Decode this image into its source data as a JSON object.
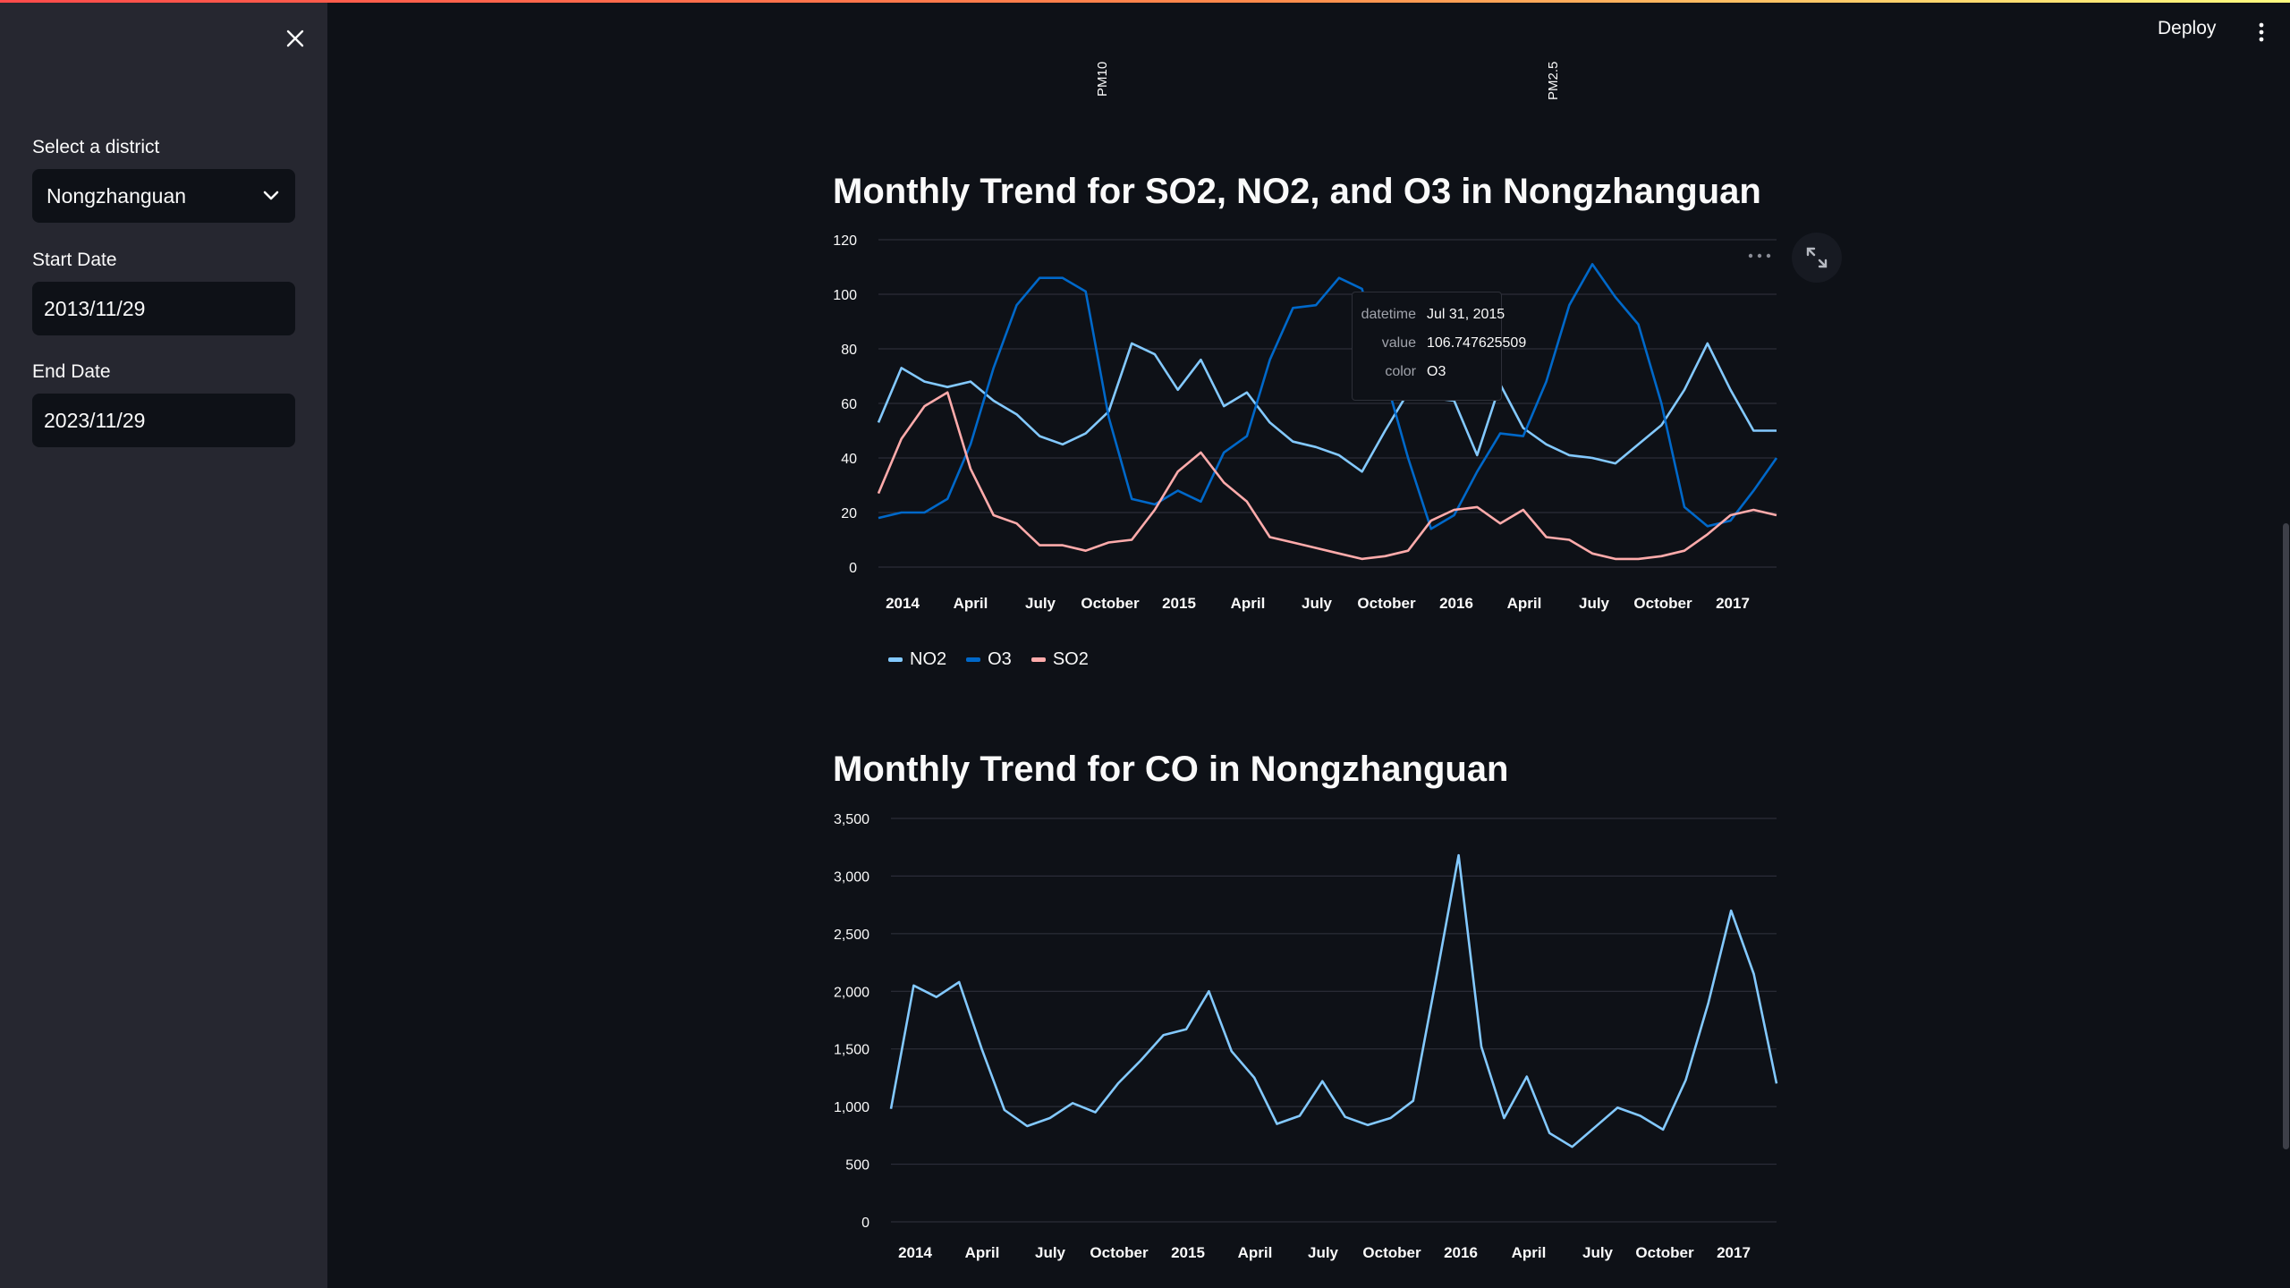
{
  "window": {
    "deploy_label": "Deploy"
  },
  "sidebar": {
    "district_label": "Select a district",
    "district_value": "Nongzhanguan",
    "start_label": "Start Date",
    "start_value": "2013/11/29",
    "end_label": "End Date",
    "end_value": "2023/11/29"
  },
  "above_fold_labels": [
    "PM10",
    "PM2.5"
  ],
  "colors": {
    "background": "#0e1117",
    "sidebar": "#262730",
    "NO2": "#83c9ff",
    "O3": "#0068c9",
    "SO2": "#ffabab",
    "CO": "#83c9ff"
  },
  "icons": [
    "close-icon",
    "chevron-down-icon",
    "more-vert-icon",
    "more-horiz-icon",
    "fullscreen-icon"
  ],
  "chart1_title": "Monthly Trend for SO2, NO2, and O3 in Nongzhanguan",
  "chart2_title": "Monthly Trend for CO in Nongzhanguan",
  "tooltip": {
    "rows": [
      {
        "key": "datetime",
        "value": "Jul 31, 2015"
      },
      {
        "key": "value",
        "value": "106.747625509"
      },
      {
        "key": "color",
        "value": "O3"
      }
    ]
  },
  "chart_data": [
    {
      "type": "line",
      "title": "Monthly Trend for SO2, NO2, and O3 in Nongzhanguan",
      "x_ticks": [
        "2014",
        "April",
        "July",
        "October",
        "2015",
        "April",
        "July",
        "October",
        "2016",
        "April",
        "July",
        "October",
        "2017"
      ],
      "y_ticks": [
        "0",
        "20",
        "40",
        "60",
        "80",
        "100",
        "120"
      ],
      "ylim": [
        0,
        120
      ],
      "legend": [
        "NO2",
        "O3",
        "SO2"
      ],
      "legend_position": "bottom-left",
      "grid": true,
      "x_months": [
        "2013-11",
        "2013-12",
        "2014-01",
        "2014-02",
        "2014-03",
        "2014-04",
        "2014-05",
        "2014-06",
        "2014-07",
        "2014-08",
        "2014-09",
        "2014-10",
        "2014-11",
        "2014-12",
        "2015-01",
        "2015-02",
        "2015-03",
        "2015-04",
        "2015-05",
        "2015-06",
        "2015-07",
        "2015-08",
        "2015-09",
        "2015-10",
        "2015-11",
        "2015-12",
        "2016-01",
        "2016-02",
        "2016-03",
        "2016-04",
        "2016-05",
        "2016-06",
        "2016-07",
        "2016-08",
        "2016-09",
        "2016-10",
        "2016-11",
        "2016-12",
        "2017-01",
        "2017-02"
      ],
      "series": [
        {
          "name": "NO2",
          "values": [
            53,
            73,
            68,
            66,
            68,
            61,
            56,
            48,
            45,
            49,
            57,
            82,
            78,
            65,
            76,
            59,
            64,
            53,
            46,
            44,
            41,
            35,
            50,
            64,
            62,
            61,
            41,
            67,
            51,
            45,
            41,
            40,
            38,
            45,
            52,
            65,
            82,
            65,
            50,
            50
          ]
        },
        {
          "name": "O3",
          "values": [
            18,
            20,
            20,
            25,
            45,
            73,
            96,
            106,
            106,
            101,
            55,
            25,
            23,
            28,
            24,
            42,
            48,
            76,
            95,
            96,
            106,
            102,
            70,
            40,
            14,
            19,
            35,
            49,
            48,
            68,
            96,
            111,
            99,
            89,
            60,
            22,
            15,
            17,
            28,
            40
          ]
        },
        {
          "name": "SO2",
          "values": [
            27,
            47,
            59,
            64,
            36,
            19,
            16,
            8,
            8,
            6,
            9,
            10,
            21,
            35,
            42,
            31,
            24,
            11,
            9,
            7,
            5,
            3,
            4,
            6,
            17,
            21,
            22,
            16,
            21,
            11,
            10,
            5,
            3,
            3,
            4,
            6,
            12,
            19,
            21,
            19
          ]
        }
      ]
    },
    {
      "type": "line",
      "title": "Monthly Trend for CO in Nongzhanguan",
      "x_ticks": [
        "2014",
        "April",
        "July",
        "October",
        "2015",
        "April",
        "July",
        "October",
        "2016",
        "April",
        "July",
        "October",
        "2017"
      ],
      "y_ticks": [
        "0",
        "500",
        "1,000",
        "1,500",
        "2,000",
        "2,500",
        "3,000",
        "3,500"
      ],
      "ylim": [
        0,
        3500
      ],
      "grid": true,
      "x_months": [
        "2013-11",
        "2013-12",
        "2014-01",
        "2014-02",
        "2014-03",
        "2014-04",
        "2014-05",
        "2014-06",
        "2014-07",
        "2014-08",
        "2014-09",
        "2014-10",
        "2014-11",
        "2014-12",
        "2015-01",
        "2015-02",
        "2015-03",
        "2015-04",
        "2015-05",
        "2015-06",
        "2015-07",
        "2015-08",
        "2015-09",
        "2015-10",
        "2015-11",
        "2015-12",
        "2016-01",
        "2016-02",
        "2016-03",
        "2016-04",
        "2016-05",
        "2016-06",
        "2016-07",
        "2016-08",
        "2016-09",
        "2016-10",
        "2016-11",
        "2016-12",
        "2017-01",
        "2017-02"
      ],
      "series": [
        {
          "name": "CO",
          "values": [
            980,
            2050,
            1950,
            2080,
            1500,
            970,
            830,
            900,
            1030,
            950,
            1200,
            1400,
            1620,
            1670,
            2000,
            1480,
            1250,
            850,
            920,
            1220,
            910,
            840,
            900,
            1050,
            2100,
            3180,
            1520,
            900,
            1260,
            770,
            650,
            820,
            990,
            920,
            800,
            1230,
            1900,
            2700,
            2150,
            1200
          ]
        }
      ]
    }
  ]
}
